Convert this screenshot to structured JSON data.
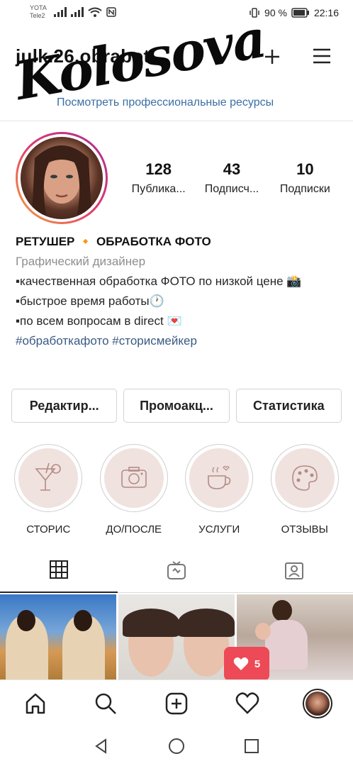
{
  "status_bar": {
    "carrier_1": "YOTA",
    "carrier_2": "Tele2",
    "battery_percent": "90 %",
    "time": "22:16"
  },
  "header": {
    "username": "julk.26.obrabot...",
    "overlay_text": "Kolosova",
    "pro_link": "Посмотреть профессиональные ресурсы"
  },
  "profile": {
    "stats": [
      {
        "value": "128",
        "label": "Публика..."
      },
      {
        "value": "43",
        "label": "Подписч..."
      },
      {
        "value": "10",
        "label": "Подписки"
      }
    ],
    "bio": {
      "name": "РЕТУШЕР 🔸 ОБРАБОТКА ФОТО",
      "category": "Графический дизайнер",
      "line1": "▪качественная обработка ФОТО по низкой цене 📸",
      "line2": "▪быстрое время работы🕐",
      "line3": "▪по всем вопросам в direct 💌",
      "hashtags": "#обработкафото #сторисмейкер"
    }
  },
  "actions": {
    "edit": "Редактир...",
    "promo": "Промоакц...",
    "stats": "Статистика"
  },
  "highlights": [
    {
      "label": "СТОРИС",
      "icon": "cocktail-icon"
    },
    {
      "label": "ДО/ПОСЛЕ",
      "icon": "camera-icon"
    },
    {
      "label": "УСЛУГИ",
      "icon": "coffee-cup-icon"
    },
    {
      "label": "ОТЗЫВЫ",
      "icon": "palette-icon"
    }
  ],
  "notification": {
    "likes_count": "5"
  },
  "colors": {
    "accent_link": "#3a6ea5",
    "like_red": "#ed4956"
  }
}
